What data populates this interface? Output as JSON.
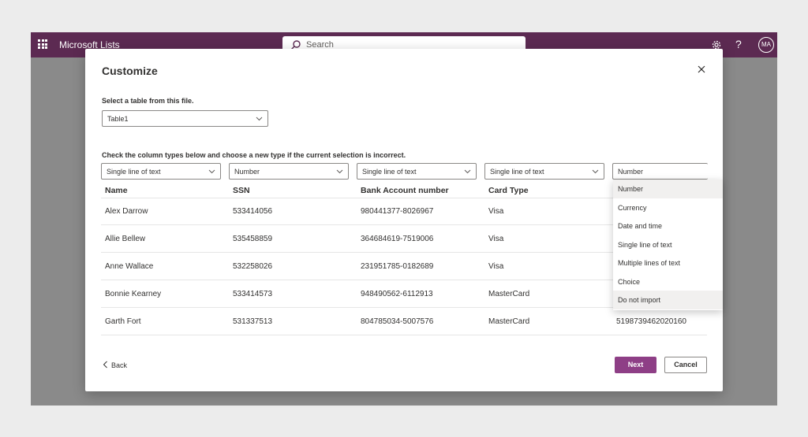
{
  "topbar": {
    "app_title": "Microsoft Lists",
    "search_placeholder": "Search",
    "avatar_initials": "MA",
    "help_glyph": "?",
    "icons": [
      "waffle-icon",
      "search-icon",
      "gear-icon",
      "help-icon"
    ]
  },
  "dialog": {
    "title": "Customize",
    "table_prompt": "Select a table from this file.",
    "table_selected": "Table1",
    "types_prompt": "Check the column types below and choose a new type if the current selection is incorrect.",
    "column_types": [
      "Single line of text",
      "Number",
      "Single line of text",
      "Single line of text",
      "Number"
    ],
    "columns": [
      "Name",
      "SSN",
      "Bank Account number",
      "Card Type"
    ],
    "rows": [
      [
        "Alex Darrow",
        "533414056",
        "980441377-8026967",
        "Visa",
        ""
      ],
      [
        "Allie Bellew",
        "535458859",
        "364684619-7519006",
        "Visa",
        ""
      ],
      [
        "Anne Wallace",
        "532258026",
        "231951785-0182689",
        "Visa",
        ""
      ],
      [
        "Bonnie Kearney",
        "533414573",
        "948490562-6112913",
        "MasterCard",
        ""
      ],
      [
        "Garth Fort",
        "531337513",
        "804785034-5007576",
        "MasterCard",
        "5198739462020160"
      ]
    ],
    "type_menu": [
      "Number",
      "Currency",
      "Date and time",
      "Single line of text",
      "Multiple lines of text",
      "Choice",
      "Do not import"
    ],
    "back_label": "Back",
    "next_label": "Next",
    "cancel_label": "Cancel"
  },
  "colors": {
    "topbar": "#5c2a52",
    "accent": "#8e3f86"
  }
}
